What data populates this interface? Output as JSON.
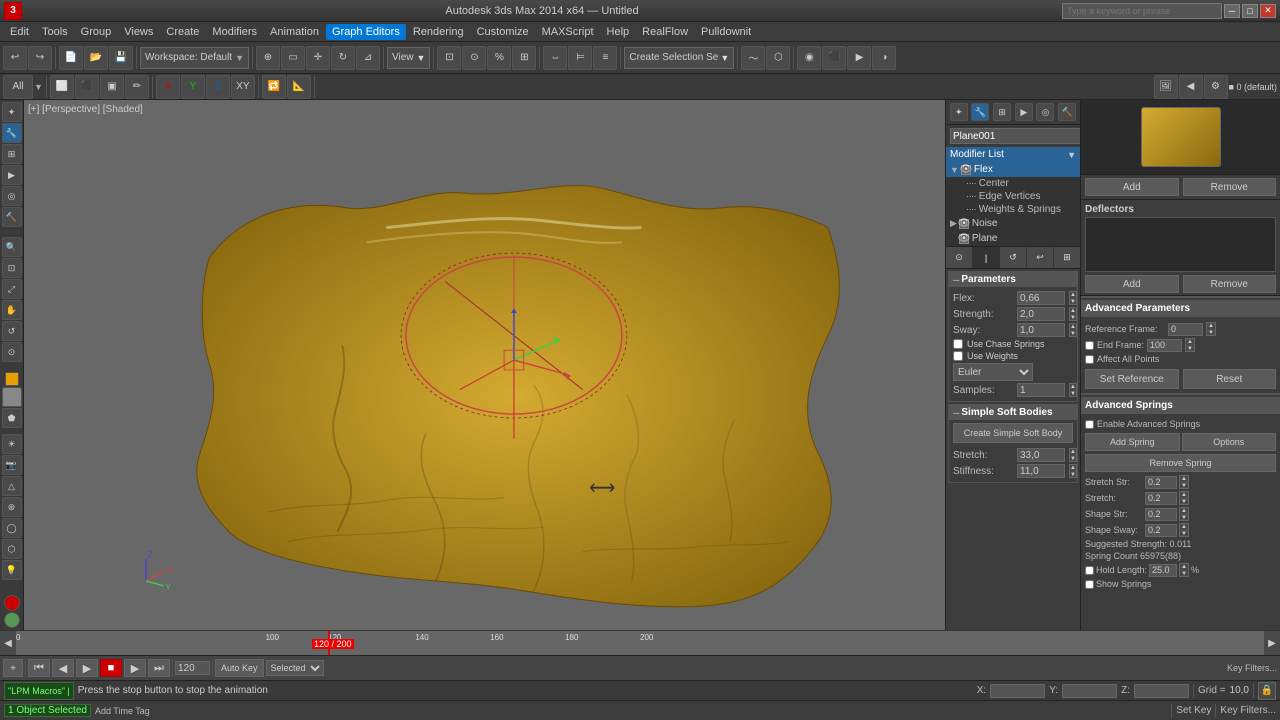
{
  "titlebar": {
    "appname": "Autodesk 3ds Max 2014 x64",
    "filename": "Untitled",
    "search_placeholder": "Type a keyword or phrase",
    "close_label": "✕",
    "min_label": "─",
    "max_label": "□"
  },
  "menubar": {
    "items": [
      "Edit",
      "Tools",
      "Group",
      "Views",
      "Create",
      "Modifiers",
      "Animation",
      "Graph Editors",
      "Rendering",
      "Customize",
      "MAXScript",
      "Help",
      "RealFlow",
      "Pulldownit"
    ]
  },
  "toolbar": {
    "workspace_label": "Workspace: Default",
    "view_label": "View",
    "select_label": "Select"
  },
  "viewport": {
    "label": "[+] [Perspective] [Shaded]"
  },
  "modifier_panel": {
    "object_name": "Plane001",
    "modifier_list_label": "Modifier List",
    "modifiers": [
      {
        "name": "Flex",
        "level": 0,
        "selected": true
      },
      {
        "name": "Center",
        "level": 1
      },
      {
        "name": "Edge Vertices",
        "level": 1
      },
      {
        "name": "Weights & Springs",
        "level": 1
      },
      {
        "name": "Noise",
        "level": 0
      },
      {
        "name": "Plane",
        "level": 0
      }
    ]
  },
  "parameters": {
    "section_title": "Parameters",
    "flex_label": "Flex:",
    "flex_value": "0,66",
    "strength_label": "Strength:",
    "strength_value": "2,0",
    "sway_label": "Sway:",
    "sway_value": "1,0",
    "use_chase_springs": "Use Chase Springs",
    "use_weights": "Use Weights",
    "euler_label": "Euler",
    "samples_label": "Samples:",
    "samples_value": "1"
  },
  "soft_bodies": {
    "title": "Simple Soft Bodies",
    "create_btn": "Create Simple Soft Body",
    "stretch_label": "Stretch:",
    "stretch_value": "33,0",
    "stiffness_label": "Stiffness:",
    "stiffness_value": "11,0"
  },
  "advanced_params": {
    "title": "Advanced Parameters",
    "ref_frame_label": "Reference Frame:",
    "ref_frame_value": "0",
    "end_frame_label": "End Frame:",
    "end_frame_value": "100",
    "affect_all_pts": "Affect All Points",
    "set_reference_btn": "Set Reference",
    "reset_btn": "Reset"
  },
  "advanced_springs": {
    "title": "Advanced Springs",
    "enable_label": "Enable Advanced Springs",
    "add_spring_btn": "Add Spring",
    "options_btn": "Options",
    "remove_spring_btn": "Remove Spring",
    "stretch_str_label": "Stretch Str:",
    "stretch_str_value": "0.2",
    "stretch_label": "Stretch:",
    "stretch_value": "0.2",
    "shape_str_label": "Shape Str:",
    "shape_str_value": "0.2",
    "shape_sway_label": "Shape Sway:",
    "shape_sway_value": "0.2",
    "suggested_strength": "Suggested Strength: 0.011",
    "spring_count": "Spring Count 65975(88)",
    "hold_length_label": "Hold Length:",
    "hold_length_value": "25.0",
    "pct_label": "%",
    "show_springs_label": "Show Springs"
  },
  "deflectors": {
    "title": "Deflectors",
    "add_btn": "Add",
    "remove_btn": "Remove"
  },
  "statusbar": {
    "objects_selected": "1 Object Selected",
    "message": "Press the stop button to stop the animation",
    "x_label": "X:",
    "y_label": "Y:",
    "z_label": "Z:",
    "grid_label": "Grid =",
    "grid_value": "10,0",
    "autokey_label": "Auto Key",
    "selected_mode": "Selected"
  },
  "timeline": {
    "current": "120",
    "total": "200",
    "ticks": [
      "0",
      "100",
      "120",
      "140",
      "160",
      "180",
      "200"
    ]
  },
  "keybar": {
    "set_key_btn": "Set Key",
    "key_filters_btn": "Key Filters...",
    "current_frame": "120"
  },
  "bottom_toolbar": {
    "lpm_tag": "\"LPM Macros\" |"
  }
}
